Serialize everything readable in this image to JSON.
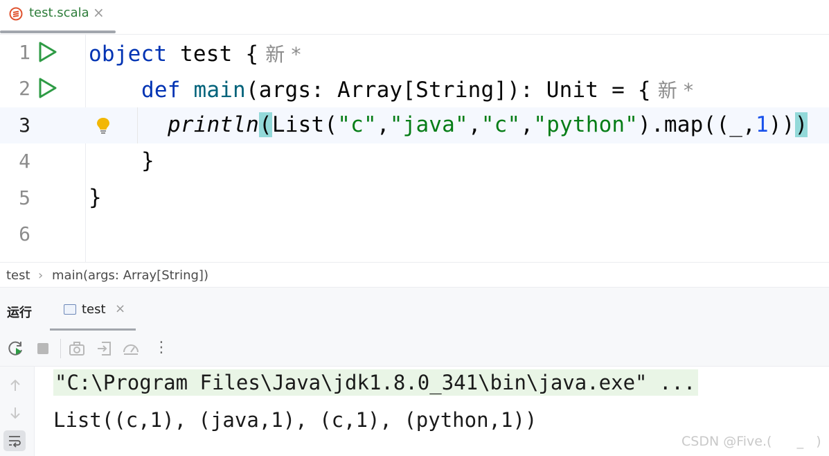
{
  "tab": {
    "filename": "test.scala",
    "close": "×",
    "icon": "scala-file-icon"
  },
  "editor": {
    "lines": [
      {
        "number": "1"
      },
      {
        "number": "2"
      },
      {
        "number": "3"
      },
      {
        "number": "4"
      },
      {
        "number": "5"
      },
      {
        "number": "6"
      }
    ],
    "code": {
      "l1_kw": "object",
      "l1_name": " test {",
      "l1_hint": "新 *",
      "l2_kw": "def",
      "l2_fn": "main",
      "l2_rest": "(args: Array[String]): Unit = {",
      "l2_hint": "新 *",
      "l3_fn": "println",
      "l3_open": "(",
      "l3_a": "List(",
      "l3_s1": "\"c\"",
      "l3_c1": ",",
      "l3_s2": "\"java\"",
      "l3_c2": ",",
      "l3_s3": "\"c\"",
      "l3_c3": ",",
      "l3_s4": "\"python\"",
      "l3_b": ").map((_,",
      "l3_num": "1",
      "l3_c": "))",
      "l3_close": ")",
      "l4": "}",
      "l5": "}"
    }
  },
  "breadcrumb": {
    "item1": "test",
    "sep": "›",
    "item2": "main(args: Array[String])"
  },
  "run_panel": {
    "title": "运行",
    "tab_label": "test",
    "tab_close": "×",
    "more": "⋮"
  },
  "console": {
    "command": "\"C:\\Program Files\\Java\\jdk1.8.0_341\\bin\\java.exe\" ...",
    "output": "List((c,1), (java,1), (c,1), (python,1))"
  },
  "watermark": "CSDN @Five.(      _   )"
}
